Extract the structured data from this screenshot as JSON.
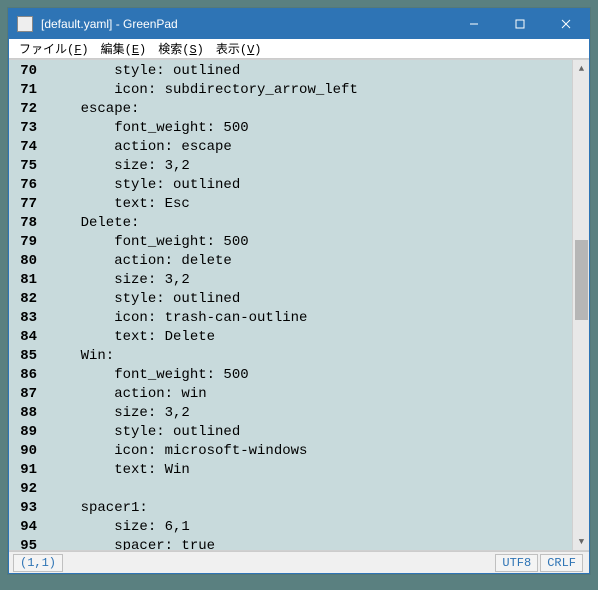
{
  "window": {
    "title": "[default.yaml] - GreenPad"
  },
  "menu": {
    "file": {
      "label": "ファイル",
      "accel": "F"
    },
    "edit": {
      "label": "編集",
      "accel": "E"
    },
    "search": {
      "label": "検索",
      "accel": "S"
    },
    "view": {
      "label": "表示",
      "accel": "V"
    }
  },
  "editor": {
    "first_line_no": 70,
    "lines": [
      "        style: outlined",
      "        icon: subdirectory_arrow_left",
      "    escape:",
      "        font_weight: 500",
      "        action: escape",
      "        size: 3,2",
      "        style: outlined",
      "        text: Esc",
      "    Delete:",
      "        font_weight: 500",
      "        action: delete",
      "        size: 3,2",
      "        style: outlined",
      "        icon: trash-can-outline",
      "        text: Delete",
      "    Win:",
      "        font_weight: 500",
      "        action: win",
      "        size: 3,2",
      "        style: outlined",
      "        icon: microsoft-windows",
      "        text: Win",
      "",
      "    spacer1:",
      "        size: 6,1",
      "        spacer: true"
    ]
  },
  "status": {
    "cursor": "(1,1)",
    "encoding": "UTF8",
    "eol": "CRLF"
  }
}
